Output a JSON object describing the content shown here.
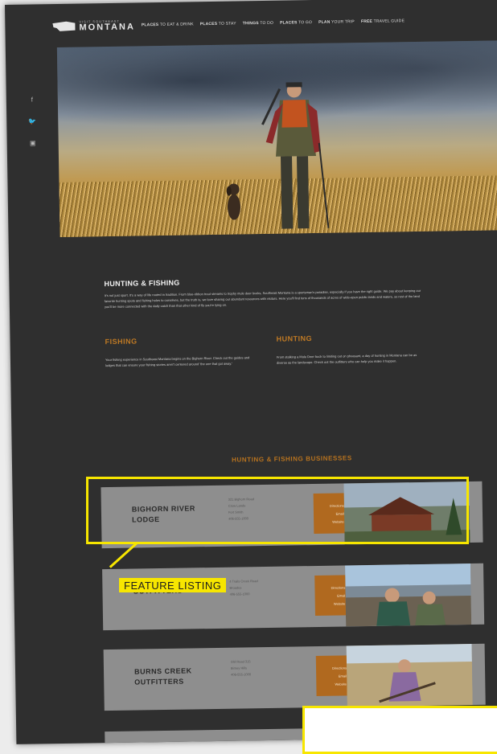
{
  "header": {
    "logo_small": "VISIT SOUTHEAST",
    "logo_big": "MONTANA",
    "menu": [
      {
        "bold": "PLACES",
        "rest": " TO EAT & DRINK"
      },
      {
        "bold": "PLACES",
        "rest": " TO STAY"
      },
      {
        "bold": "THINGS",
        "rest": " TO DO"
      },
      {
        "bold": "PLACES",
        "rest": " TO GO"
      },
      {
        "bold": "PLAN",
        "rest": " YOUR TRIP"
      },
      {
        "bold": "FREE",
        "rest": " TRAVEL GUIDE"
      }
    ]
  },
  "social": [
    {
      "glyph": "f",
      "icon": "facebook-icon"
    },
    {
      "glyph": "🐦",
      "icon": "twitter-icon"
    },
    {
      "glyph": "▣",
      "icon": "instagram-icon"
    }
  ],
  "intro": {
    "title": "HUNTING & FISHING",
    "body": "It's not just sport. It's a way of life rooted in tradition. From blue-ribbon trout streams to trophy mule deer bucks, Southeast Montana is a sportsman's paradise, especially if you have the right guide. We pay about keeping our favorite hunting spots and fishing holes to ourselves, but the truth is, we love sharing our abundant resources with visitors. Here you'll find tons of thousands of acres of wide-open public lands and waters, so rest of the land you'll be more connected with the daily catch than that other kind of fly you're tying on."
  },
  "fishing": {
    "title": "FISHING",
    "body": "Your fishing experience in Southeast Montana begins on the Bighorn River. Check out the guides and lodges that can ensure your fishing stories aren't centered around 'the one that got away.'"
  },
  "hunting": {
    "title": "HUNTING",
    "body": "From stalking a Mule Deer buck to limiting out on pheasant, a day of hunting in Montana can be as diverse as the landscape. Check out the outfitters who can help you make it happen."
  },
  "businesses_title": "HUNTING & FISHING BUSINESSES",
  "actions": {
    "directions": "Directions",
    "email": "Email",
    "website": "Website"
  },
  "listings": [
    {
      "name_line1": "BIGHORN RIVER",
      "name_line2": "LODGE",
      "addr": [
        "321 Bighorn Road",
        "Crow Lands",
        "Fort Smith",
        "406-555-1000"
      ]
    },
    {
      "name_line1": "",
      "name_line2": "OUTFITTERS",
      "addr": [
        "4 Trails Creek Road",
        "Broadus",
        "406-555-1000"
      ]
    },
    {
      "name_line1": "BURNS CREEK",
      "name_line2": "OUTFITTERS",
      "addr": [
        "Old Road 315",
        "Birney Hills",
        "406-555-1000"
      ]
    }
  ],
  "annotation": {
    "label": "FEATURE LISTING"
  },
  "colors": {
    "accent": "#b0691f",
    "highlight": "#f7e600",
    "background": "#2f2f2f"
  }
}
